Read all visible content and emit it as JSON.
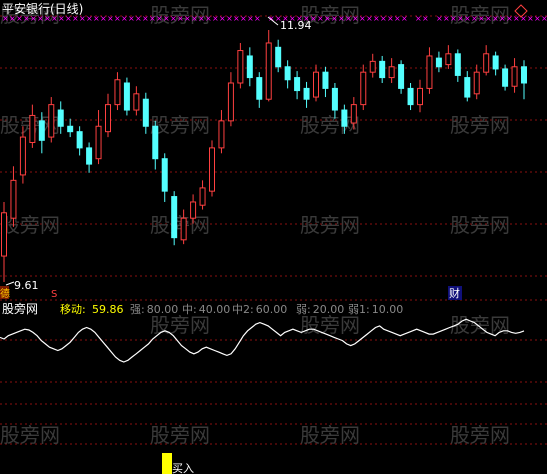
{
  "title": "平安银行(日线)",
  "price_high_label": "11.94",
  "price_low_label": "9.61",
  "marker_de": "德",
  "marker_s": "S",
  "marker_cai": "财",
  "indicator": {
    "name": "移动:",
    "value": "59.86",
    "levels": [
      {
        "label": "强:",
        "value": "80.00"
      },
      {
        "label": "中:",
        "value": "40.00"
      },
      {
        "label": "中2:",
        "value": "60.00"
      },
      {
        "label": "弱:",
        "value": "20.00"
      },
      {
        "label": "弱1:",
        "value": "10.00"
      }
    ]
  },
  "buy_label": "买入",
  "watermark": "股旁网",
  "colors": {
    "background": "#000000",
    "up": "#ff4040",
    "down": "#54ffff",
    "grid": "#8a1010",
    "marker": "#ff00ff",
    "white": "#ffffff",
    "yellow": "#ffff00",
    "title": "#ffffff"
  },
  "chart_data": {
    "type": "candlestick",
    "title": "平安银行(日线)",
    "ylim": [
      9.61,
      11.94
    ],
    "candles": [
      {
        "o": 9.85,
        "c": 10.25,
        "h": 10.35,
        "l": 9.61
      },
      {
        "o": 10.2,
        "c": 10.55,
        "h": 10.68,
        "l": 10.12
      },
      {
        "o": 10.6,
        "c": 10.95,
        "h": 11.05,
        "l": 10.52
      },
      {
        "o": 10.9,
        "c": 11.15,
        "h": 11.25,
        "l": 10.85
      },
      {
        "o": 11.1,
        "c": 10.92,
        "h": 11.18,
        "l": 10.8
      },
      {
        "o": 10.95,
        "c": 11.25,
        "h": 11.32,
        "l": 10.9
      },
      {
        "o": 11.2,
        "c": 11.05,
        "h": 11.28,
        "l": 10.98
      },
      {
        "o": 11.05,
        "c": 11.0,
        "h": 11.12,
        "l": 10.95
      },
      {
        "o": 11.0,
        "c": 10.85,
        "h": 11.05,
        "l": 10.78
      },
      {
        "o": 10.85,
        "c": 10.7,
        "h": 10.9,
        "l": 10.62
      },
      {
        "o": 10.75,
        "c": 11.05,
        "h": 11.2,
        "l": 10.7
      },
      {
        "o": 11.0,
        "c": 11.25,
        "h": 11.35,
        "l": 10.95
      },
      {
        "o": 11.25,
        "c": 11.48,
        "h": 11.55,
        "l": 11.2
      },
      {
        "o": 11.45,
        "c": 11.2,
        "h": 11.5,
        "l": 11.15
      },
      {
        "o": 11.2,
        "c": 11.35,
        "h": 11.42,
        "l": 11.15
      },
      {
        "o": 11.3,
        "c": 11.05,
        "h": 11.36,
        "l": 10.98
      },
      {
        "o": 11.05,
        "c": 10.75,
        "h": 11.1,
        "l": 10.65
      },
      {
        "o": 10.75,
        "c": 10.45,
        "h": 10.8,
        "l": 10.35
      },
      {
        "o": 10.4,
        "c": 10.02,
        "h": 10.45,
        "l": 9.95
      },
      {
        "o": 10.0,
        "c": 10.2,
        "h": 10.28,
        "l": 9.96
      },
      {
        "o": 10.2,
        "c": 10.35,
        "h": 10.42,
        "l": 10.15
      },
      {
        "o": 10.32,
        "c": 10.48,
        "h": 10.55,
        "l": 10.28
      },
      {
        "o": 10.45,
        "c": 10.85,
        "h": 10.92,
        "l": 10.4
      },
      {
        "o": 10.85,
        "c": 11.1,
        "h": 11.2,
        "l": 10.8
      },
      {
        "o": 11.1,
        "c": 11.45,
        "h": 11.55,
        "l": 11.05
      },
      {
        "o": 11.45,
        "c": 11.75,
        "h": 11.82,
        "l": 11.4
      },
      {
        "o": 11.7,
        "c": 11.5,
        "h": 11.78,
        "l": 11.42
      },
      {
        "o": 11.5,
        "c": 11.3,
        "h": 11.55,
        "l": 11.22
      },
      {
        "o": 11.3,
        "c": 11.82,
        "h": 11.94,
        "l": 11.28
      },
      {
        "o": 11.78,
        "c": 11.6,
        "h": 11.85,
        "l": 11.55
      },
      {
        "o": 11.6,
        "c": 11.48,
        "h": 11.66,
        "l": 11.4
      },
      {
        "o": 11.5,
        "c": 11.38,
        "h": 11.56,
        "l": 11.3
      },
      {
        "o": 11.4,
        "c": 11.3,
        "h": 11.46,
        "l": 11.22
      },
      {
        "o": 11.32,
        "c": 11.55,
        "h": 11.62,
        "l": 11.28
      },
      {
        "o": 11.55,
        "c": 11.4,
        "h": 11.6,
        "l": 11.32
      },
      {
        "o": 11.4,
        "c": 11.2,
        "h": 11.45,
        "l": 11.12
      },
      {
        "o": 11.2,
        "c": 11.05,
        "h": 11.25,
        "l": 10.98
      },
      {
        "o": 11.08,
        "c": 11.25,
        "h": 11.32,
        "l": 11.02
      },
      {
        "o": 11.25,
        "c": 11.55,
        "h": 11.62,
        "l": 11.2
      },
      {
        "o": 11.55,
        "c": 11.65,
        "h": 11.72,
        "l": 11.5
      },
      {
        "o": 11.65,
        "c": 11.5,
        "h": 11.7,
        "l": 11.45
      },
      {
        "o": 11.5,
        "c": 11.6,
        "h": 11.68,
        "l": 11.45
      },
      {
        "o": 11.62,
        "c": 11.4,
        "h": 11.66,
        "l": 11.35
      },
      {
        "o": 11.4,
        "c": 11.25,
        "h": 11.45,
        "l": 11.2
      },
      {
        "o": 11.25,
        "c": 11.4,
        "h": 11.48,
        "l": 11.18
      },
      {
        "o": 11.4,
        "c": 11.7,
        "h": 11.78,
        "l": 11.35
      },
      {
        "o": 11.68,
        "c": 11.6,
        "h": 11.74,
        "l": 11.55
      },
      {
        "o": 11.62,
        "c": 11.72,
        "h": 11.8,
        "l": 11.58
      },
      {
        "o": 11.72,
        "c": 11.52,
        "h": 11.76,
        "l": 11.46
      },
      {
        "o": 11.5,
        "c": 11.32,
        "h": 11.56,
        "l": 11.28
      },
      {
        "o": 11.35,
        "c": 11.55,
        "h": 11.62,
        "l": 11.3
      },
      {
        "o": 11.55,
        "c": 11.72,
        "h": 11.8,
        "l": 11.52
      },
      {
        "o": 11.7,
        "c": 11.58,
        "h": 11.74,
        "l": 11.52
      },
      {
        "o": 11.58,
        "c": 11.42,
        "h": 11.62,
        "l": 11.38
      },
      {
        "o": 11.42,
        "c": 11.6,
        "h": 11.68,
        "l": 11.36
      },
      {
        "o": 11.6,
        "c": 11.45,
        "h": 11.66,
        "l": 11.3
      }
    ],
    "indicator_series": [
      52,
      50,
      54,
      56,
      58,
      60,
      62,
      61,
      58,
      54,
      48,
      44,
      40,
      38,
      36,
      38,
      42,
      46,
      52,
      58,
      62,
      64,
      62,
      58,
      52,
      46,
      40,
      34,
      28,
      24,
      22,
      24,
      28,
      32,
      36,
      40,
      44,
      50,
      54,
      58,
      60,
      58,
      54,
      48,
      42,
      38,
      34,
      32,
      34,
      38,
      40,
      38,
      36,
      34,
      32,
      30,
      32,
      38,
      46,
      54,
      60,
      64,
      68,
      70,
      68,
      66,
      62,
      58,
      54,
      58,
      60,
      62,
      60,
      58,
      60,
      62,
      62,
      60,
      58,
      56,
      54,
      52,
      50,
      48,
      44,
      42,
      44,
      48,
      52,
      56,
      60,
      64,
      66,
      62,
      60,
      58,
      56,
      54,
      56,
      58,
      60,
      62,
      60,
      58,
      56,
      56,
      58,
      60,
      62,
      64,
      66,
      68,
      72,
      74,
      72,
      70,
      66,
      62,
      58,
      56,
      54,
      58,
      60,
      60,
      58,
      57,
      58,
      59.86
    ],
    "levels": [
      80,
      60,
      40,
      20,
      10
    ]
  }
}
